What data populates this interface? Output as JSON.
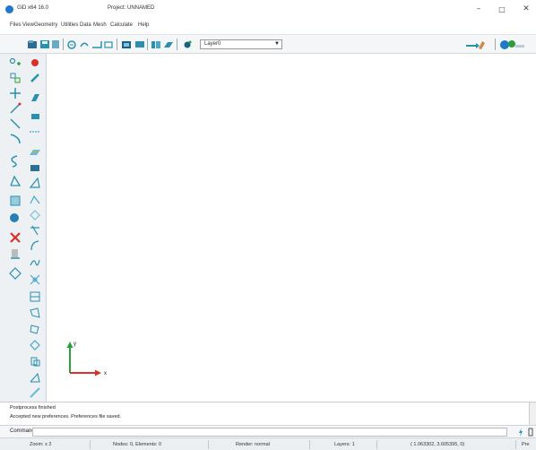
{
  "window": {
    "app_title": "GiD x64 16.0",
    "project_title": "Project: UNNAMED",
    "minimize_glyph": "–",
    "maximize_glyph": "□",
    "close_glyph": "✕"
  },
  "menu": [
    "Files",
    "View",
    "Geometry",
    "Utilities",
    "Data",
    "Mesh",
    "Calculate",
    "Help"
  ],
  "toolbar": {
    "layer_select_value": "Layer0"
  },
  "canvas": {
    "axis_x_label": "x",
    "axis_y_label": "y"
  },
  "messages": {
    "line1": "Postprocess finished",
    "line2": "Accepted new preferences. Preferences file saved."
  },
  "command": {
    "label": "Command:",
    "value": ""
  },
  "status": {
    "zoom": "Zoom: x 2",
    "nodes_elements": "Nodes: 0, Elements: 0",
    "render": "Render: normal",
    "layers": "Layers: 1",
    "coords": "( 1.063302, 3.605395, 0)",
    "pre": "Pre"
  },
  "colors": {
    "accent_blue": "#1f78c8",
    "toolbar_teal": "#2b8fb0",
    "axis_x_red": "#d8302a",
    "axis_y_green": "#2aa03a",
    "toolbar_bg": "#f4f6f8"
  }
}
